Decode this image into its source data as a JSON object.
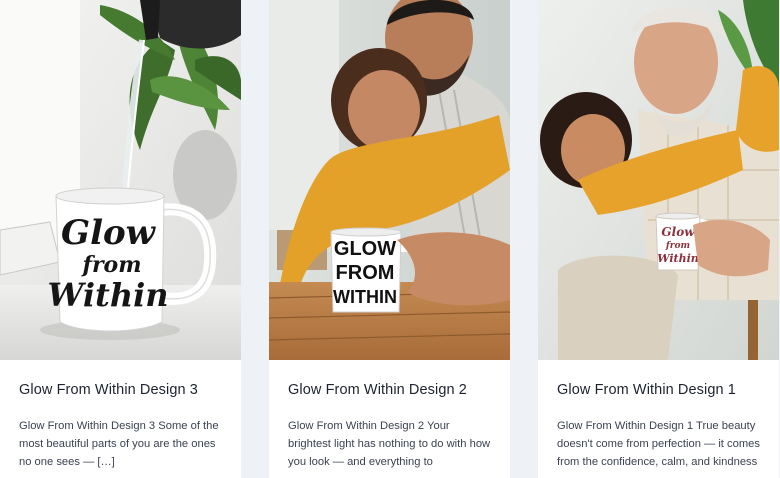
{
  "posts": [
    {
      "title": "Glow From Within Design 3",
      "excerpt": "Glow From Within Design 3 Some of the most beautiful parts of you are the ones no one sees — […]",
      "mug_text": [
        "Glow",
        "from",
        "Within"
      ]
    },
    {
      "title": "Glow From Within Design 2",
      "excerpt": "Glow From Within Design 2 Your brightest light has nothing to do with how you look — and everything to",
      "mug_text": [
        "GLOW",
        "FROM",
        "WITHIN"
      ]
    },
    {
      "title": "Glow From Within Design 1",
      "excerpt": "Glow From Within Design 1 True beauty doesn't come from perfection — it comes from the confidence, calm, and kindness",
      "mug_text": [
        "Glow",
        "from",
        "Within"
      ]
    }
  ]
}
